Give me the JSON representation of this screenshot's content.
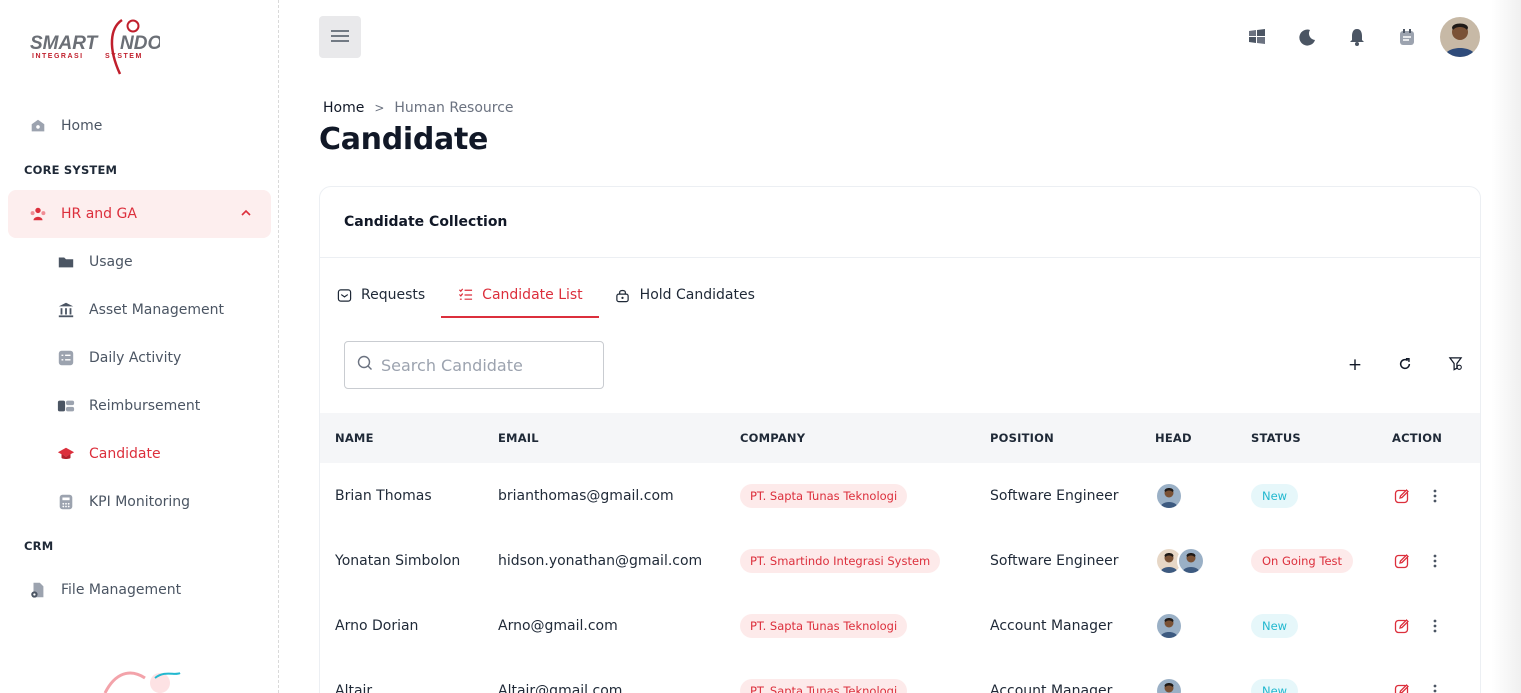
{
  "brand": {
    "logo_text": "SMARTINDO",
    "logo_subtext": "INTEGRASI SYSTEM",
    "primary_color": "#dc2f3c"
  },
  "sidebar": {
    "home": "Home",
    "section_core": "CORE SYSTEM",
    "hr_ga": "HR and GA",
    "sub_items": [
      {
        "label": "Usage",
        "icon": "folder-icon"
      },
      {
        "label": "Asset Management",
        "icon": "bank-icon"
      },
      {
        "label": "Daily Activity",
        "icon": "checklist-icon"
      },
      {
        "label": "Reimbursement",
        "icon": "money-icon"
      },
      {
        "label": "Candidate",
        "icon": "graduation-cap-icon"
      },
      {
        "label": "KPI Monitoring",
        "icon": "calculator-icon"
      }
    ],
    "section_crm": "CRM",
    "file_management": "File Management"
  },
  "breadcrumb": {
    "home": "Home",
    "separator": ">",
    "current": "Human Resource"
  },
  "page": {
    "title": "Candidate"
  },
  "card": {
    "title": "Candidate Collection"
  },
  "tabs": [
    {
      "label": "Requests",
      "icon": "inbox-icon"
    },
    {
      "label": "Candidate List",
      "icon": "list-icon",
      "active": true
    },
    {
      "label": "Hold Candidates",
      "icon": "lock-icon"
    }
  ],
  "search": {
    "placeholder": "Search Candidate",
    "value": ""
  },
  "tools": {
    "add": "+"
  },
  "table": {
    "columns": [
      "NAME",
      "EMAIL",
      "COMPANY",
      "POSITION",
      "HEAD",
      "STATUS",
      "ACTION"
    ],
    "rows": [
      {
        "name": "Brian Thomas",
        "email": "brianthomas@gmail.com",
        "company": "PT. Sapta Tunas Teknologi",
        "position": "Software Engineer",
        "heads": 1,
        "status": "New",
        "status_type": "new"
      },
      {
        "name": "Yonatan Simbolon",
        "email": "hidson.yonathan@gmail.com",
        "company": "PT. Smartindo Integrasi System",
        "position": "Software Engineer",
        "heads": 2,
        "status": "On Going Test",
        "status_type": "ongoing"
      },
      {
        "name": "Arno Dorian",
        "email": "Arno@gmail.com",
        "company": "PT. Sapta Tunas Teknologi",
        "position": "Account Manager",
        "heads": 1,
        "status": "New",
        "status_type": "new"
      },
      {
        "name": "Altair",
        "email": "Altair@gmail.com",
        "company": "PT. Sapta Tunas Teknologi",
        "position": "Account Manager",
        "heads": 1,
        "status": "New",
        "status_type": "new"
      }
    ]
  }
}
